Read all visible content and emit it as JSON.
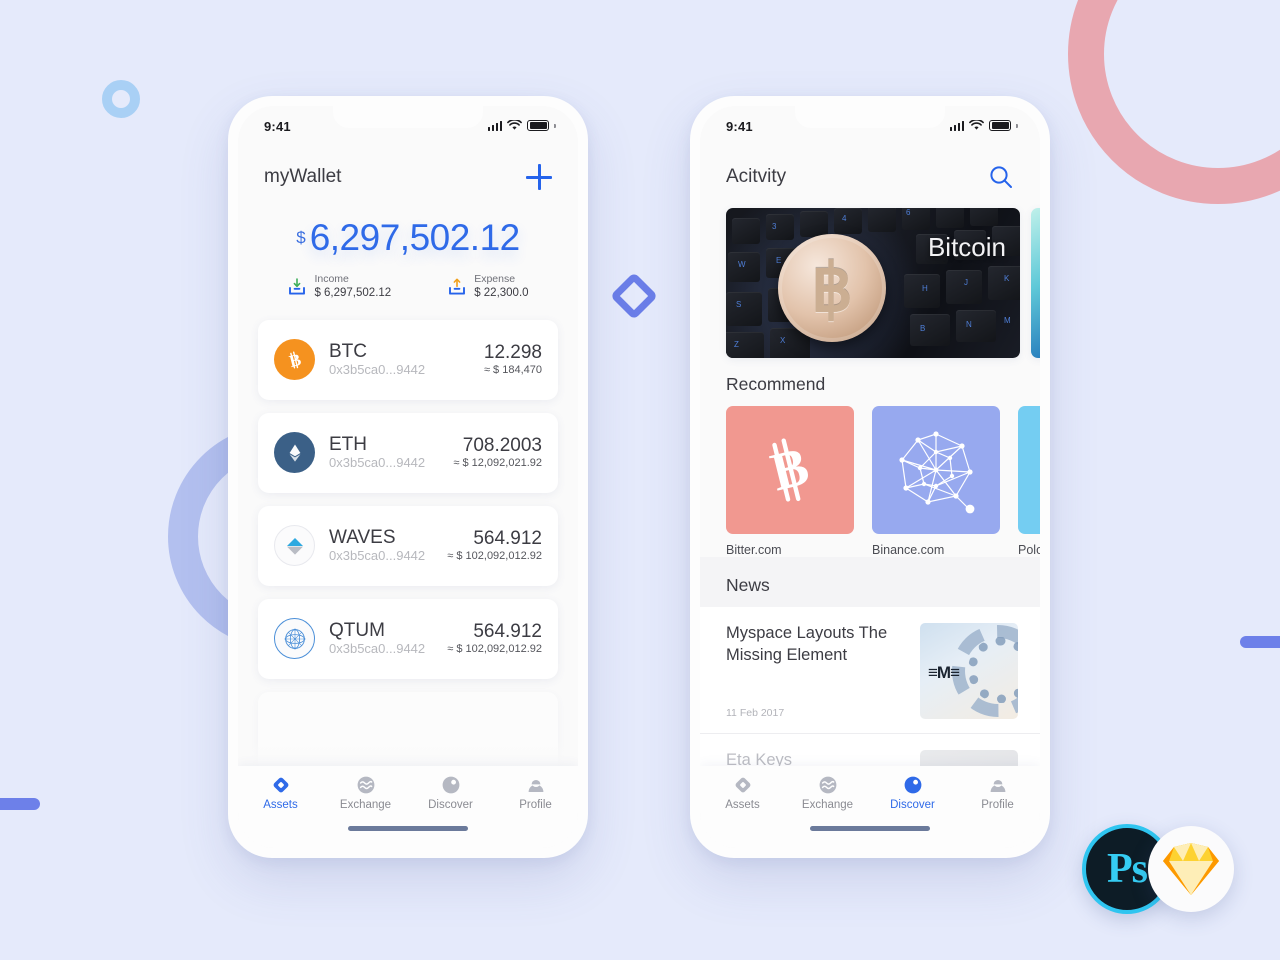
{
  "colors": {
    "background": "#e5eafb",
    "accent_blue": "#2f6ae8",
    "pink_arc": "#e8a7b0",
    "periwinkle": "#b3c0ef",
    "bar_blue": "#6d80e9",
    "donut_blue": "#a9d0f5",
    "btc_orange": "#f5921f",
    "eth_blue": "#3b6087",
    "waves_blue": "#2ea9e0",
    "qtum_blue": "#3f8fd4"
  },
  "phone_assets": {
    "status_bar": {
      "time": "9:41",
      "icons": [
        "signal-icon",
        "wifi-icon",
        "battery-icon"
      ]
    },
    "nav": {
      "title": "myWallet",
      "action_icon": "plus-icon"
    },
    "balance": {
      "currency_symbol": "$",
      "amount": "6,297,502.12",
      "income": {
        "icon": "download-arrow-icon",
        "label": "Income",
        "value": "$ 6,297,502.12"
      },
      "expense": {
        "icon": "upload-arrow-icon",
        "label": "Expense",
        "value": "$ 22,300.0"
      }
    },
    "assets": [
      {
        "symbol": "BTC",
        "icon": "bitcoin-icon",
        "address": "0x3b5ca0...9442",
        "amount": "12.298",
        "fiat": "≈ $ 184,470"
      },
      {
        "symbol": "ETH",
        "icon": "ethereum-icon",
        "address": "0x3b5ca0...9442",
        "amount": "708.2003",
        "fiat": "≈ $ 12,092,021.92"
      },
      {
        "symbol": "WAVES",
        "icon": "waves-icon",
        "address": "0x3b5ca0...9442",
        "amount": "564.912",
        "fiat": "≈ $ 102,092,012.92"
      },
      {
        "symbol": "QTUM",
        "icon": "qtum-icon",
        "address": "0x3b5ca0...9442",
        "amount": "564.912",
        "fiat": "≈ $ 102,092,012.92"
      }
    ],
    "tabs": [
      {
        "label": "Assets",
        "icon": "assets-diamond-icon",
        "active": true
      },
      {
        "label": "Exchange",
        "icon": "exchange-waves-icon",
        "active": false
      },
      {
        "label": "Discover",
        "icon": "discover-circle-icon",
        "active": false
      },
      {
        "label": "Profile",
        "icon": "profile-person-icon",
        "active": false
      }
    ]
  },
  "phone_discover": {
    "status_bar": {
      "time": "9:41",
      "icons": [
        "signal-icon",
        "wifi-icon",
        "battery-icon"
      ]
    },
    "nav": {
      "title": "Acitvity",
      "action_icon": "search-icon"
    },
    "banners": [
      {
        "caption": "Bitcoin",
        "image": "bitcoin-coin-on-keyboard"
      },
      {
        "caption": "",
        "image": "abstract-blue-teal"
      }
    ],
    "recommend": {
      "heading": "Recommend",
      "items": [
        {
          "label": "Bitter.com",
          "tile_color": "#f19890",
          "icon": "bitcoin-b-icon"
        },
        {
          "label": "Binance.com",
          "tile_color": "#97a9ef",
          "icon": "network-polyhedron-icon"
        },
        {
          "label": "Polone",
          "tile_color": "#74cdf2",
          "icon": "sparkle-icon"
        }
      ]
    },
    "news": {
      "heading": "News",
      "items": [
        {
          "title": "Myspace Layouts The Missing Element",
          "date": "11 Feb 2017",
          "thumb": "ibm-server-rings-image"
        },
        {
          "title": "Eta Keys",
          "date": "",
          "thumb": "person-silhouette-image"
        }
      ]
    },
    "tabs": [
      {
        "label": "Assets",
        "icon": "assets-diamond-icon",
        "active": false
      },
      {
        "label": "Exchange",
        "icon": "exchange-waves-icon",
        "active": false
      },
      {
        "label": "Discover",
        "icon": "discover-circle-icon",
        "active": true
      },
      {
        "label": "Profile",
        "icon": "profile-person-icon",
        "active": false
      }
    ]
  },
  "tool_badges": [
    {
      "name": "photoshop-logo",
      "label": "Ps"
    },
    {
      "name": "sketch-logo",
      "label": ""
    }
  ]
}
